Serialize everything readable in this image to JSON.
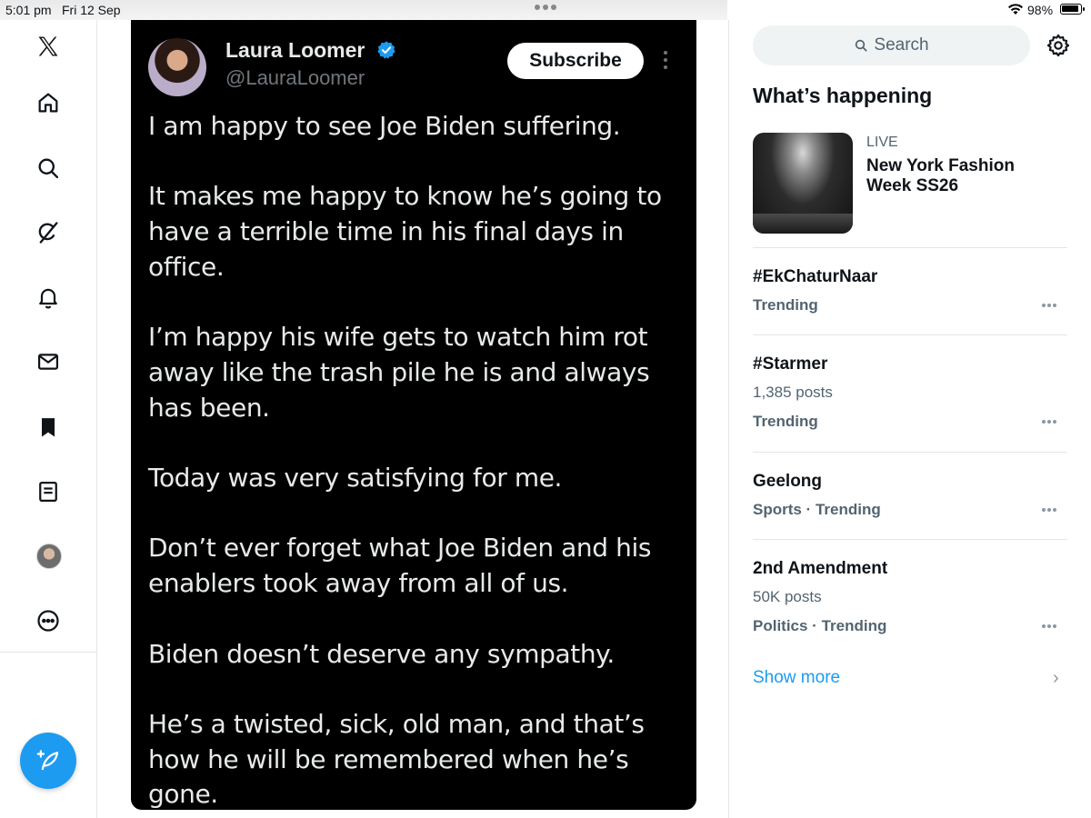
{
  "status_bar": {
    "time": "5:01 pm",
    "date": "Fri 12 Sep",
    "battery": "98%",
    "battery_level": 0.98
  },
  "nav": {
    "items": [
      "x-logo-icon",
      "home-icon",
      "search-icon",
      "grok-icon",
      "notifications-icon",
      "messages-icon",
      "bookmarks-icon",
      "lists-icon",
      "profile-avatar",
      "more-icon"
    ],
    "compose_icon": "compose-feather-icon"
  },
  "tweet": {
    "author_name": "Laura Loomer",
    "handle": "@LauraLoomer",
    "verified": true,
    "subscribe_label": "Subscribe",
    "body": "I am happy to see Joe Biden suffering.\n\nIt makes me happy to know he’s going to have a terrible time in his final days in office.\n\nI’m happy his wife gets to watch him rot away like the trash pile he is and always has been.\n\nToday was very satisfying for me.\n\nDon’t ever forget what Joe Biden and his enablers took away from all of us.\n\nBiden doesn’t deserve any sympathy.\n\nHe’s a twisted, sick, old man, and that’s how he will be remembered when he’s gone."
  },
  "sidebar": {
    "search_placeholder": "Search",
    "section_title": "What’s happening",
    "live": {
      "label": "LIVE",
      "title": "New York Fashion Week SS26"
    },
    "trends": [
      {
        "name": "#EkChaturNaar",
        "posts": "",
        "meta": "Trending"
      },
      {
        "name": "#Starmer",
        "posts": "1,385 posts",
        "meta": "Trending"
      },
      {
        "name": "Geelong",
        "posts": "",
        "meta": "Sports · Trending"
      },
      {
        "name": "2nd Amendment",
        "posts": "50K posts",
        "meta": "Politics · Trending"
      }
    ],
    "show_more": "Show more"
  },
  "colors": {
    "accent": "#1d9bf0",
    "tweet_bg": "#000000",
    "muted": "#536471"
  }
}
